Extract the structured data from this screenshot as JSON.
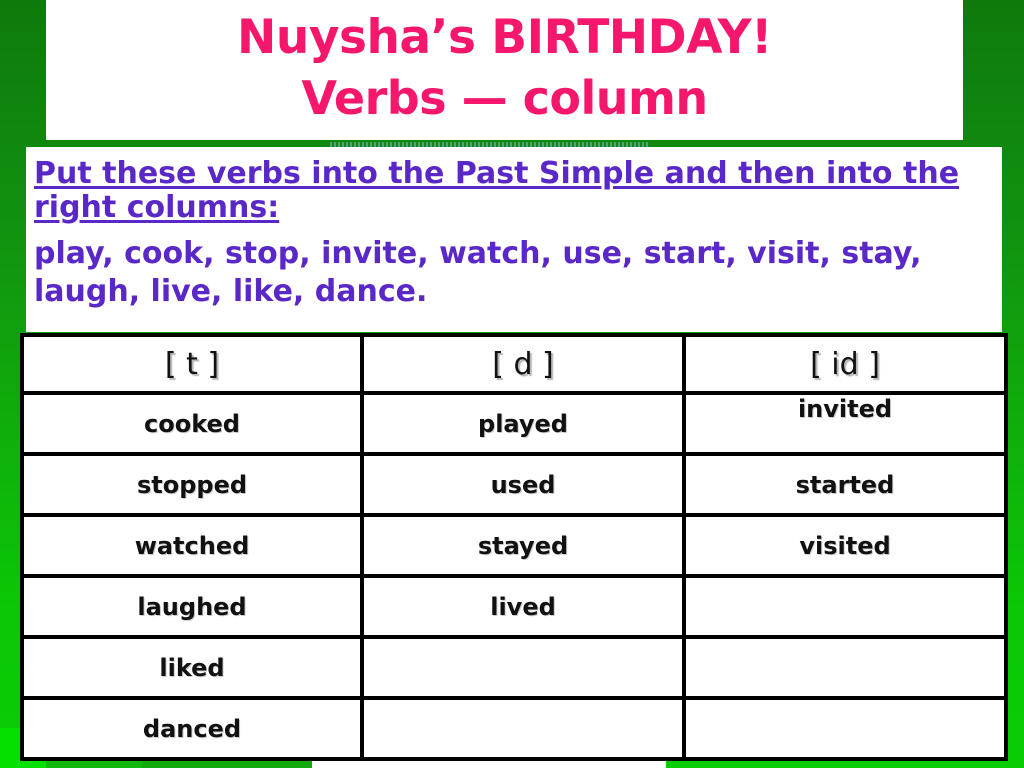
{
  "slide": {
    "background_color": "#0FA80B",
    "title": {
      "line1": "Nuysha’s BIRTHDAY!",
      "line2": "Verbs — column",
      "color": "#F5176B"
    },
    "instructions": {
      "heading": "Put these verbs into the Past Simple and then into the right columns:",
      "verb_list": "play, cook, stop, invite, watch, use, start, visit, stay, laugh, live, like, dance.",
      "color": "#5B28C8"
    },
    "table": {
      "headers": [
        "[ t ]",
        "[ d ]",
        "[ id ]"
      ],
      "rows": [
        [
          "cooked",
          "played",
          "invited"
        ],
        [
          "stopped",
          "used",
          "started"
        ],
        [
          "watched",
          "stayed",
          "visited"
        ],
        [
          "laughed",
          "lived",
          ""
        ],
        [
          "liked",
          "",
          ""
        ],
        [
          "danced",
          "",
          ""
        ]
      ]
    }
  }
}
